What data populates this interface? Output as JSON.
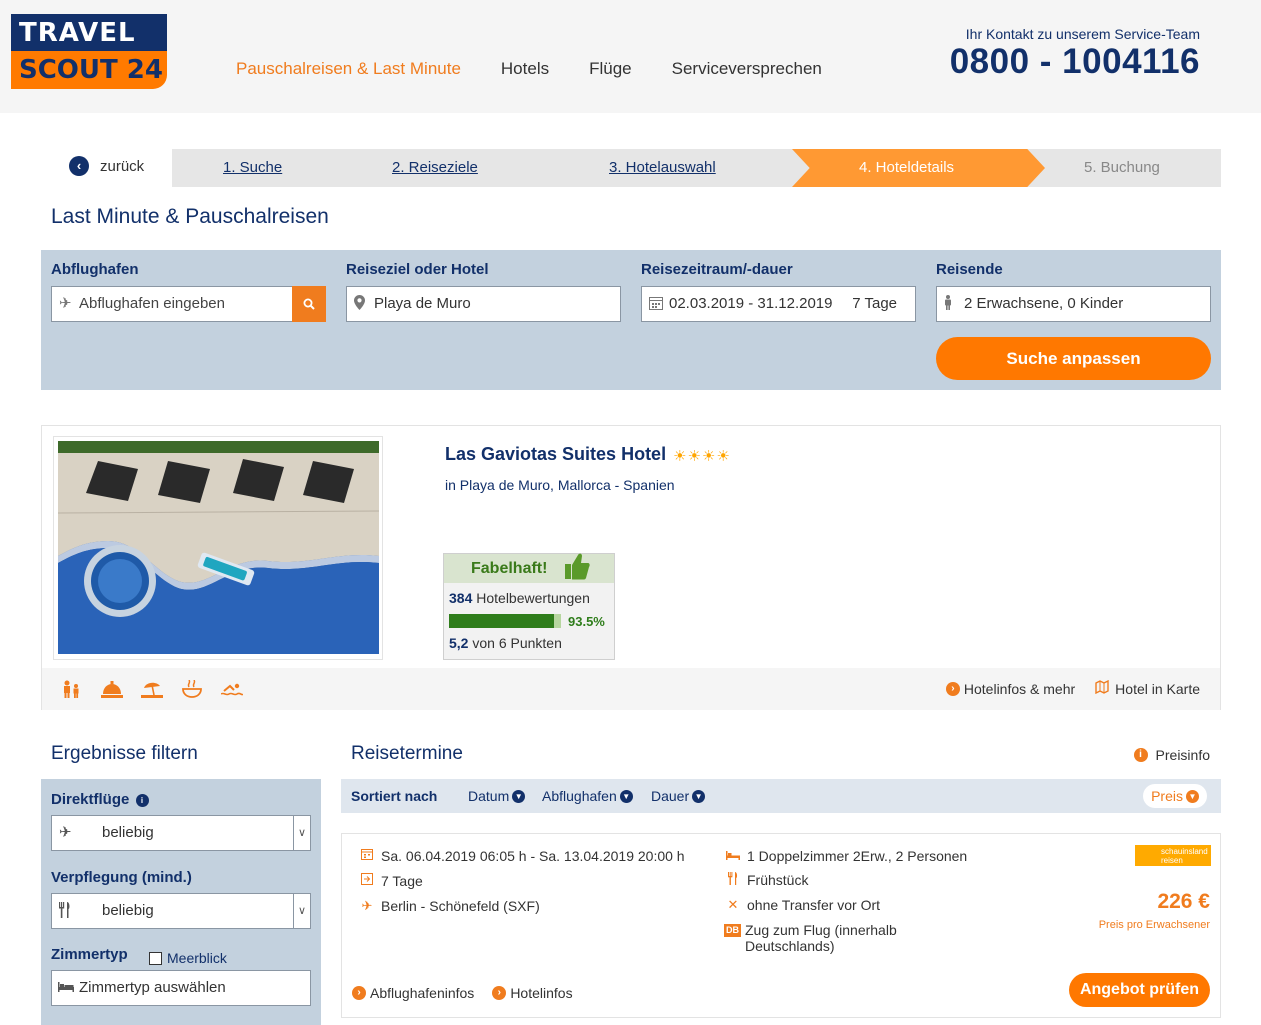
{
  "header": {
    "logo_top": "TRAVEL",
    "logo_bottom": "SCOUT 24",
    "nav": [
      "Pauschalreisen & Last Minute",
      "Hotels",
      "Flüge",
      "Serviceversprechen"
    ],
    "contact_label": "Ihr Kontakt zu unserem Service-Team",
    "contact_phone": "0800 - 1004116"
  },
  "steps": {
    "back": "zurück",
    "items": [
      "1. Suche",
      "2. Reiseziele",
      "3. Hotelauswahl",
      "4. Hoteldetails",
      "5. Buchung"
    ],
    "current_index": 3
  },
  "page_title": "Last Minute & Pauschalreisen",
  "search": {
    "airport_label": "Abflughafen",
    "airport_placeholder": "Abflughafen eingeben",
    "destination_label": "Reiseziel oder Hotel",
    "destination_value": "Playa de Muro",
    "period_label": "Reisezeitraum/-dauer",
    "period_value": "02.03.2019 - 31.12.2019",
    "duration_value": "7 Tage",
    "travelers_label": "Reisende",
    "travelers_value": "2 Erwachsene, 0 Kinder",
    "submit": "Suche anpassen"
  },
  "hotel": {
    "name": "Las Gaviotas Suites Hotel",
    "stars": 4,
    "location": "in Playa de Muro, Mallorca - Spanien",
    "rating_label": "Fabelhaft!",
    "reviews_count": "384",
    "reviews_label": "Hotelbewertungen",
    "recommend_pct": "93.5%",
    "recommend_fraction": 0.935,
    "score": "5,2",
    "score_suffix": "von 6 Punkten",
    "link_info": "Hotelinfos & mehr",
    "link_map": "Hotel in Karte",
    "amenity_icons": [
      "family-icon",
      "service-bell-icon",
      "beach-icon",
      "spa-icon",
      "swimming-icon"
    ]
  },
  "filter": {
    "title": "Ergebnisse filtern",
    "direct_label": "Direktflüge",
    "direct_value": "beliebig",
    "board_label": "Verpflegung (mind.)",
    "board_value": "beliebig",
    "room_label": "Zimmertyp",
    "seaview_label": "Meerblick",
    "room_placeholder": "Zimmertyp auswählen"
  },
  "results": {
    "title": "Reisetermine",
    "price_info": "Preisinfo",
    "sort_label": "Sortiert nach",
    "sort_options": [
      "Datum",
      "Abflughafen",
      "Dauer"
    ],
    "sort_price": "Preis"
  },
  "offer": {
    "dates": "Sa. 06.04.2019 06:05 h - Sa. 13.04.2019 20:00 h",
    "duration": "7 Tage",
    "airport": "Berlin - Schönefeld (SXF)",
    "room": "1 Doppelzimmer 2Erw., 2 Personen",
    "board": "Frühstück",
    "transfer": "ohne Transfer vor Ort",
    "train_badge": "DB",
    "train": "Zug zum Flug (innerhalb Deutschlands)",
    "operator": "schauinsland reisen",
    "price": "226 €",
    "price_note": "Preis pro Erwachsener",
    "button": "Angebot prüfen",
    "link_airport": "Abflughafeninfos",
    "link_hotel": "Hotelinfos"
  },
  "colors": {
    "brand_navy": "#12306a",
    "brand_orange": "#ff7800",
    "panel_blue": "#c3d1de",
    "rating_green": "#2f7d1b"
  }
}
